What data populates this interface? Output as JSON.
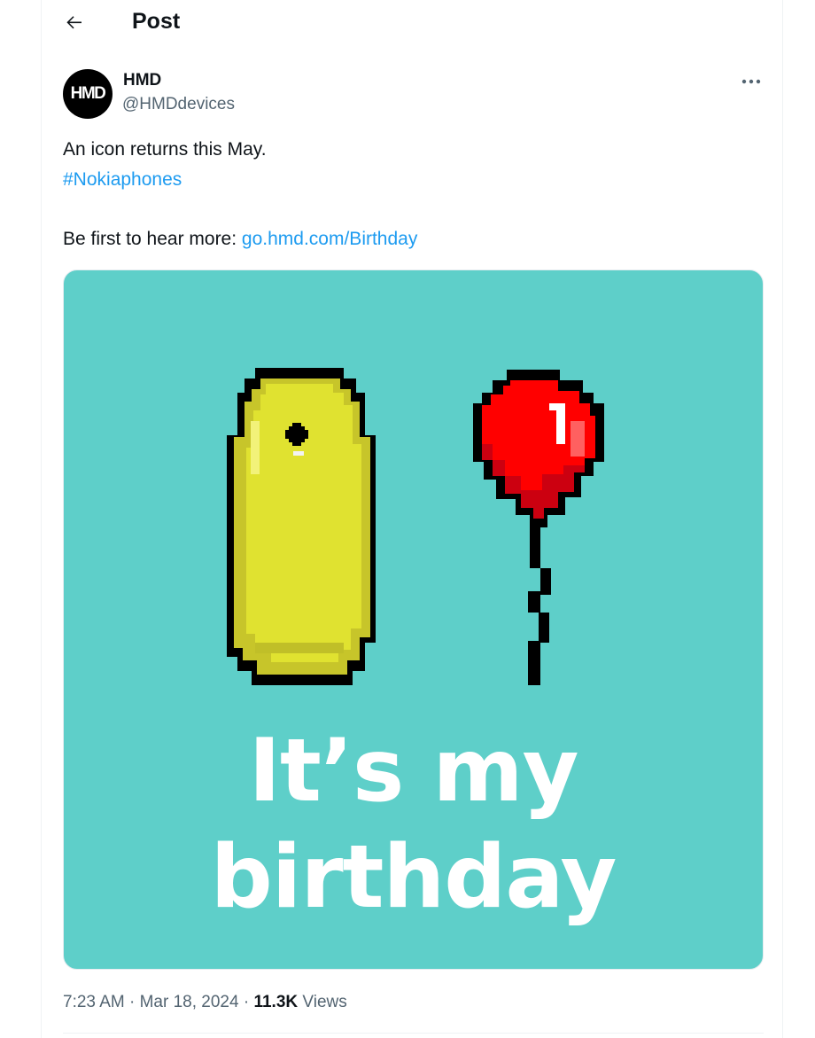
{
  "header": {
    "back_icon": "arrow-left-icon",
    "title": "Post"
  },
  "author": {
    "avatar_text": "HMD",
    "name": "HMD",
    "handle": "@HMDdevices",
    "more_icon": "more-dots-icon"
  },
  "tweet": {
    "line1": "An icon returns this May.",
    "hashtag": "#Nokiaphones",
    "line3_prefix": "Be first to hear more: ",
    "link": "go.hmd.com/Birthday"
  },
  "media": {
    "headline_line1": "It’s my",
    "headline_line2": "birthday",
    "background_color": "#5ecfc9",
    "phone_color": "#dfe22f",
    "balloon_color": "#ff0000"
  },
  "meta": {
    "time": "7:23 AM",
    "separator1": " · ",
    "date": "Mar 18, 2024",
    "separator2": " · ",
    "views_count": "11.3K",
    "views_label": " Views"
  }
}
